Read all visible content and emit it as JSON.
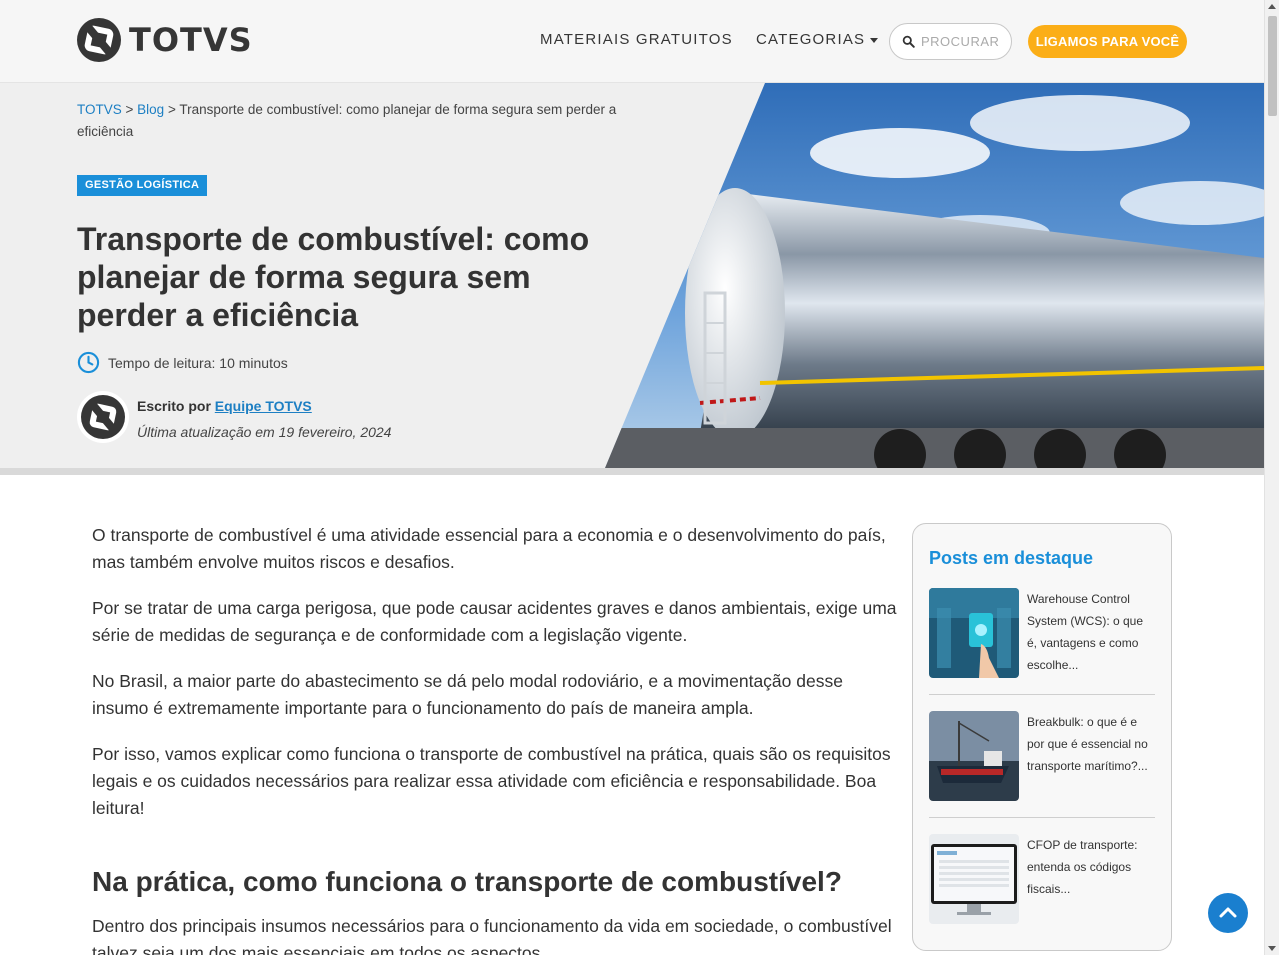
{
  "header": {
    "logo_text": "TOTVS",
    "nav": {
      "materiais": "MATERIAIS GRATUITOS",
      "categorias": "CATEGORIAS"
    },
    "search_placeholder": "PROCURAR",
    "cta_label": "LIGAMOS PARA VOCÊ"
  },
  "breadcrumb": {
    "home": "TOTVS",
    "sep1": " > ",
    "blog": "Blog",
    "sep2": " > ",
    "current": "Transporte de combustível: como planejar de forma segura sem perder a eficiência"
  },
  "hero": {
    "category_tag": "GESTÃO LOGÍSTICA",
    "title": "Transporte de combustível: como planejar de forma segura sem perder a eficiência",
    "read_time": "Tempo de leitura: 10 minutos",
    "author_prefix": "Escrito por",
    "author_name": "Equipe TOTVS",
    "updated": "Última atualização em 19 fevereiro, 2024"
  },
  "article": {
    "paragraphs": [
      "O transporte de combustível é uma atividade essencial para a economia e o desenvolvimento do país, mas também envolve muitos riscos e desafios.",
      "Por se tratar de uma carga perigosa, que pode causar acidentes graves e danos ambientais, exige uma série de medidas de segurança e de conformidade com a legislação vigente.",
      "No Brasil, a maior parte do abastecimento se dá pelo modal rodoviário, e a movimentação desse insumo é extremamente importante para o funcionamento do país de maneira ampla.",
      "Por isso, vamos explicar como funciona o transporte de combustível na prática, quais são os requisitos legais e os cuidados necessários para realizar essa atividade com eficiência e responsabilidade. Boa leitura!"
    ],
    "heading": "Na prática, como funciona o transporte de combustível?",
    "after_heading": "Dentro dos principais insumos necessários para o funcionamento da vida em sociedade, o combustível talvez seja um dos mais essenciais em todos os aspectos."
  },
  "sidebar": {
    "title": "Posts em destaque",
    "posts": [
      {
        "title": "Warehouse Control System (WCS): o que é, vantagens e como escolhe..."
      },
      {
        "title": "Breakbulk: o que é e por que é essencial no transporte marítimo?..."
      },
      {
        "title": "CFOP de transporte: entenda os códigos fiscais..."
      }
    ]
  },
  "colors": {
    "accent_blue": "#1a8fd9",
    "cta_orange": "#fbae17",
    "text_dark": "#333333"
  }
}
